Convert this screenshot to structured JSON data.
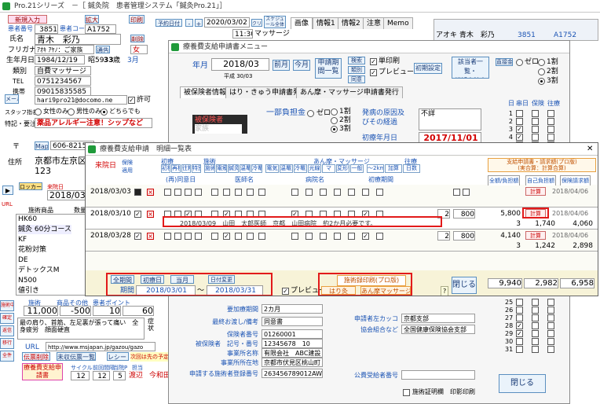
{
  "main": {
    "title": "Pro.21シリーズ　－［ 鍼灸院　患者管理システム「鍼灸Pro.21」］",
    "new_patient_btn": "新規入力",
    "enlarge_btn": "拡大",
    "print_btn": "印刷",
    "patient_no_label": "患者番号",
    "patient_no": "3851",
    "patient_code_label": "患者コード",
    "patient_code": "A1752",
    "name_label": "氏名",
    "name": "青木　彩乃",
    "delete_btn": "削除",
    "kana_label": "フリガナ",
    "kana": "ｱｵｷ ｱﾔﾉ：ご家族",
    "hold_btn": "通告",
    "gender": "女",
    "birth_label": "生年月日",
    "birth": "1984/12/19",
    "age_prefix": "昭59",
    "age": "33",
    "age_unit": "歳",
    "blood": "3月",
    "kind_label": "類別",
    "kind": "自費マッサージ",
    "tel_label": "TEL",
    "tel": "0751234567",
    "mobile_label": "携帯",
    "mobile": "09015835585",
    "mail_label": "メール",
    "mail": "hari9pro21@docomo.ne",
    "mail_perm": "許可",
    "contact_label": "スタッフ指名",
    "contact_opts": [
      "女性のみ",
      "男性のみ",
      "どちらでも"
    ],
    "notes_label": "特記・要注意",
    "notes": "薬品アレルギー注意！シップなど",
    "zip_label": "〒",
    "map_btn": "Map",
    "zip": "606-8215",
    "addr_label": "住所",
    "address1": "京都市左京区",
    "address2": "123",
    "date_label": "来院日",
    "date": "2018/03/",
    "reservation_btn": "ロッカー",
    "calendar_label": "来院日",
    "items": [
      {
        "name": "HK60",
        "qty": ""
      },
      {
        "name": "鍼灸 60分コース",
        "qty": ""
      },
      {
        "name": "KF",
        "qty": ""
      },
      {
        "name": "花粉対策",
        "qty": ""
      },
      {
        "name": "DE",
        "qty": ""
      },
      {
        "name": "デトックスM",
        "qty": ""
      },
      {
        "name": "N500",
        "qty": ""
      },
      {
        "name": "値引き",
        "qty": ""
      }
    ],
    "item_hdr_name": "施術商品",
    "item_hdr_qty": "数量",
    "totals_hdr": [
      "施術",
      "商品その他",
      "患者ポイント"
    ],
    "totals": [
      "11,000",
      "-500",
      "10",
      "60"
    ],
    "symptom_label": "症状",
    "symptom_text": "最の肩り、首筋、左足裏が張って痛い　全身疲労　顔面硬直",
    "url_label": "URL",
    "url": "http://www.msjapan.jp/gazou/gazo",
    "receipt_btn": "伝票削除",
    "next_btn": "未収伝票一覧",
    "receipt2_btn": "レシート",
    "cancel_link": "次回は先の予定",
    "insurance_btn": "療養費支給申請書",
    "cycle_label": "サイクル",
    "cycle": "12",
    "interval_label": "前回間隔",
    "interval": "12",
    "points_label": "当院P",
    "points": "5",
    "staff_label": "担当",
    "staff": "渡辺",
    "staff2": "今和田",
    "side_labels": [
      "施術中",
      "確定",
      "返信",
      "移行",
      "全件"
    ],
    "top_date_btn": "予約日付",
    "top_date": "2020/03/02",
    "top_time": "11:30",
    "top_course": "マッサージ",
    "top_clear": "クリア",
    "top_schedule": "スケジュール全体",
    "tabs": [
      "画像",
      "情報1",
      "情報2",
      "注意",
      "Memo"
    ],
    "right_name": "アオキ 青木　彩乃",
    "right_code": "3851",
    "right_code2": "A1752",
    "sec_btns": [
      "歩",
      "上"
    ]
  },
  "menu_win": {
    "title": "療養費支給申請書メニュー",
    "ym_label": "年月",
    "ym": "2018/03",
    "era": "平成 30/03",
    "prev_btn": "前月",
    "cur_btn": "今月",
    "bulk_btn": "申請期間一覧",
    "search_btn": "検索",
    "class_btn": "類別",
    "same_btn": "同意",
    "separate_label": "単印刷",
    "preview_label": "プレビュー",
    "init_btn": "初期設定",
    "applicant_btn": "該当者一覧・\n総括表計表",
    "direct_label": "直接金",
    "opts": [
      "ゼロ",
      "1割",
      "2割",
      "3割"
    ],
    "tabs": [
      "被保険者情報",
      "はり・きゅう申請書発行",
      "あん摩・マッサージ申請書発行"
    ],
    "person_box": [
      "被保険者",
      "家族"
    ],
    "burden_label": "一部負担金",
    "burden_opts": [
      "ゼロ",
      "1割",
      "2割",
      "3割"
    ],
    "cause_label": "発病の原因及びその経過",
    "cause_val": "不詳",
    "onset_label": "初療年月日",
    "onset_date": "2017/11/01",
    "day_hdrs": [
      "日",
      "串日",
      "保険",
      "往療"
    ],
    "day_rows": [
      "1",
      "2",
      "3",
      "4",
      "5",
      "25",
      "26",
      "27",
      "28",
      "29",
      "30",
      "31"
    ],
    "fields": [
      {
        "label": "要加療期間",
        "value": "2カ月"
      },
      {
        "label": "最終お渡し/備考",
        "value": "同意書"
      },
      {
        "label": "保険者番号",
        "value": "01260001"
      },
      {
        "label": "被保険者　記号・番号",
        "value": "12345678　10"
      },
      {
        "label": "事業所名称",
        "value": "有限会社　ABC建設"
      },
      {
        "label": "事業所所在地",
        "value": "京都市伏見区桃山町１"
      },
      {
        "label": "申請する施術者登録番号",
        "value": "263456789012AW"
      }
    ],
    "right_fields": [
      {
        "label": "申請者左カッコ",
        "value": "京都支部"
      },
      {
        "label": "協会組合など",
        "value": "全国健康保険協会支部"
      },
      {
        "label": "公費受給者番号",
        "value": ""
      }
    ],
    "doctor_cert": "施術証明欄　印影印刷",
    "close_btn": "閉じる"
  },
  "list_win": {
    "title": "療養費支給申請　明細一覧表",
    "close_x": "✕",
    "col_visit": "来院日",
    "col_ins": "保険",
    "col_ins2": "適用",
    "grp1": "初療",
    "grp2": "施術",
    "grp3": "あん摩・マッサージ",
    "grp4": "往療",
    "h1": [
      "初検",
      "再検",
      "往料",
      "特別"
    ],
    "h2": [
      "施術",
      "電療",
      "鍼灸",
      "温罨",
      "冷罨"
    ],
    "h3": [
      "電気",
      "温罨法",
      "冷罨法",
      "光線",
      "マ",
      "変形徒手",
      "一般"
    ],
    "h4": [
      "～2km",
      "加算",
      "日数"
    ],
    "sub1": "(再)同意日",
    "sub2": "医師名",
    "sub3": "病院名",
    "sub4": "初療期間",
    "right_hdr": "支給申請書・請求額(プロ版)\n(実合算：計算合算)",
    "right_sub": [
      "全額/負担額",
      "自己負担額",
      "保険請求額"
    ],
    "rows": [
      {
        "date": "2018/03/03",
        "amount": "",
        "qty": "",
        "f1": "",
        "f2": "",
        "f3": "",
        "calc": "計算",
        "rdate": "2018/04/06",
        "line2": ""
      },
      {
        "date": "2018/03/10",
        "amount": "800",
        "qty": "2",
        "f1": "5,800",
        "f2": "3",
        "f3": "",
        "calc": "計算",
        "rdate": "2018/04/06",
        "line2": "2018/03/09　山田　太郎医師　京都　山田病院　約2か月必要です。",
        "s1": "1,740",
        "s2": "4,060"
      },
      {
        "date": "2018/03/28",
        "amount": "800",
        "qty": "2",
        "f1": "4,140",
        "f2": "3",
        "f3": "",
        "calc": "計算",
        "rdate": "2018/04/06",
        "line2": "",
        "s1": "1,242",
        "s2": "2,898"
      }
    ],
    "period_btns": [
      "全期間",
      "初療日",
      "当月",
      "日付変更"
    ],
    "period_label": "期間",
    "from": "2018/03/01",
    "tilde": "～",
    "to": "2018/03/31",
    "preview": "プレビュー",
    "print_hdr": "施術録印刷(プロ版)",
    "print_btn1": "はり灸",
    "print_btn2": "あん摩マッサージ",
    "close_btn": "閉じる",
    "sum1": "9,940",
    "sum2": "2,982",
    "sum3": "6,958"
  }
}
